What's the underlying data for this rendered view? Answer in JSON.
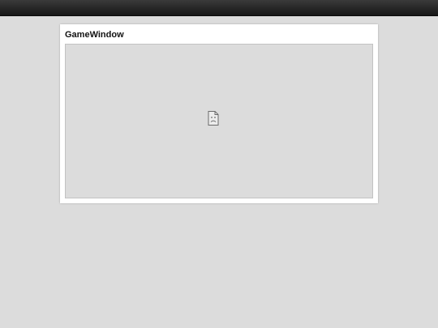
{
  "window": {
    "title": "GameWindow"
  },
  "game": {
    "icon": "broken-document-icon"
  },
  "colors": {
    "page_background": "#dcdcdc",
    "topbar": "#222222",
    "panel_background": "#ffffff"
  }
}
